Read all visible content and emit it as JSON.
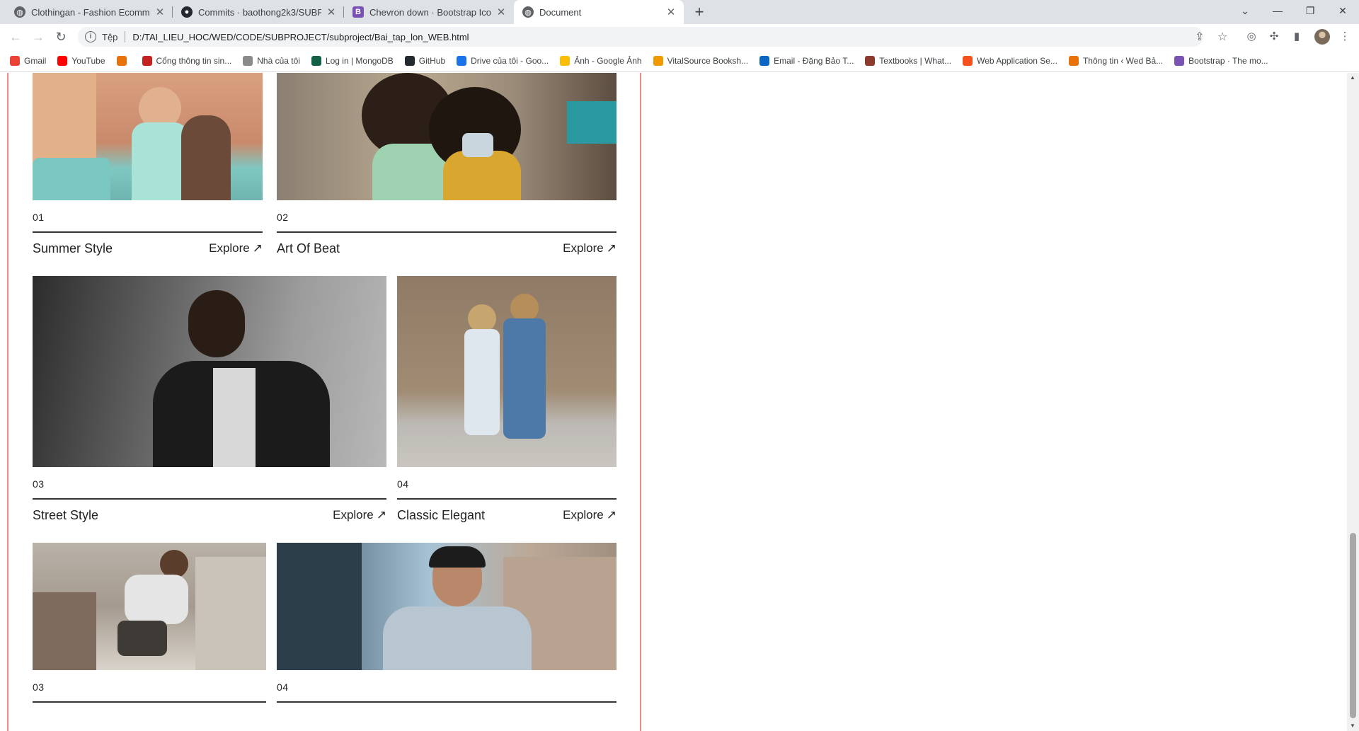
{
  "browser": {
    "tabs": [
      {
        "title": "Clothingan - Fashion Ecommerce",
        "icon": "globe-icon",
        "active": false
      },
      {
        "title": "Commits · baothong2k3/SUBPROJECT",
        "icon": "github-icon",
        "active": false
      },
      {
        "title": "Chevron down · Bootstrap Icons",
        "icon": "bootstrap-icon",
        "active": false
      },
      {
        "title": "Document",
        "icon": "globe-icon",
        "active": true
      }
    ],
    "new_tab": "+",
    "address": {
      "scheme": "Tệp",
      "url": "D:/TAI_LIEU_HOC/WED/CODE/SUBPROJECT/subproject/Bai_tap_lon_WEB.html"
    },
    "bookmarks": [
      {
        "label": "Gmail",
        "color": "#ea4335"
      },
      {
        "label": "YouTube",
        "color": "#ff0000"
      },
      {
        "label": "",
        "color": "#e8710a"
      },
      {
        "label": "Cổng thông tin sin...",
        "color": "#c5221f"
      },
      {
        "label": "Nhà của tôi",
        "color": "#8a8a8a"
      },
      {
        "label": "Log in | MongoDB",
        "color": "#116149"
      },
      {
        "label": "GitHub",
        "color": "#24292f"
      },
      {
        "label": "Drive của tôi - Goo...",
        "color": "#1a73e8"
      },
      {
        "label": "Ảnh - Google Ảnh",
        "color": "#fbbc04"
      },
      {
        "label": "VitalSource Booksh...",
        "color": "#f29900"
      },
      {
        "label": "Email - Đặng Bảo T...",
        "color": "#0a66c2"
      },
      {
        "label": "Textbooks | What...",
        "color": "#8b3a2b"
      },
      {
        "label": "Web Application Se...",
        "color": "#f4511e"
      },
      {
        "label": "Thông tin ‹ Wed Bả...",
        "color": "#e8710a"
      },
      {
        "label": "Bootstrap · The mo...",
        "color": "#7952b3"
      }
    ]
  },
  "collections": [
    {
      "number": "01",
      "name": "Summer Style",
      "explore": "Explore",
      "arrow": "↗"
    },
    {
      "number": "02",
      "name": "Art Of Beat",
      "explore": "Explore",
      "arrow": "↗"
    },
    {
      "number": "03",
      "name": "Street Style",
      "explore": "Explore",
      "arrow": "↗"
    },
    {
      "number": "04",
      "name": "Classic Elegant",
      "explore": "Explore",
      "arrow": "↗"
    },
    {
      "number": "03",
      "name": "",
      "explore": "",
      "arrow": ""
    },
    {
      "number": "04",
      "name": "",
      "explore": "",
      "arrow": ""
    }
  ],
  "colors": {
    "panel_border": "#f08a80",
    "text": "#222222"
  }
}
